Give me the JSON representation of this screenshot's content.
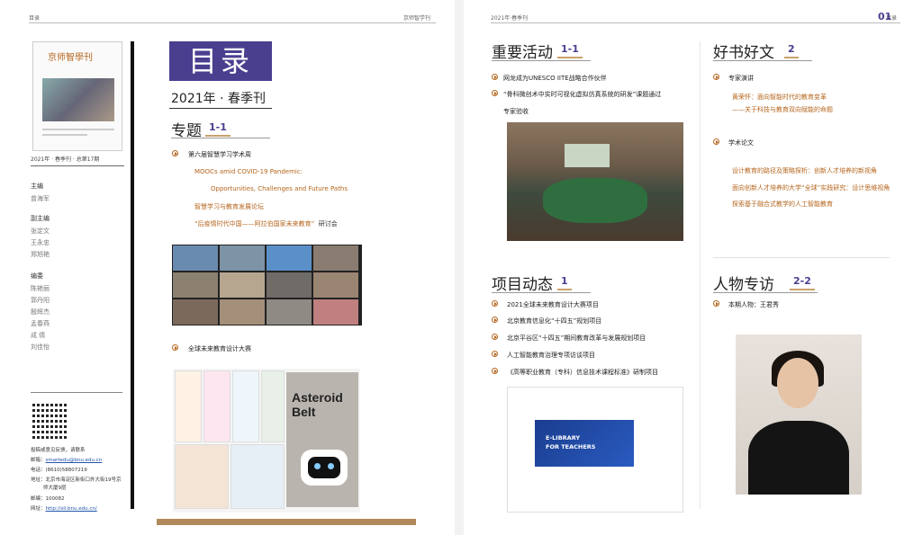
{
  "header": {
    "left_page_num": "目录",
    "left_journal": "京师智学刊",
    "right_issue": "2021年·春季刊",
    "right_label": "目录",
    "right_page_num": "01"
  },
  "cover": {
    "title": "京师智學刊",
    "issue_line": "2021年 · 春季刊 · 总第17期"
  },
  "staff": {
    "roles": [
      {
        "role": "主编",
        "names": [
          "曾海军"
        ]
      },
      {
        "role": "副主编",
        "names": [
          "张定文",
          "王永忠",
          "郑旭艳"
        ]
      },
      {
        "role": "编委",
        "names": [
          "陈艳丽",
          "郭丹阳",
          "殷辉杰",
          "孟春燕",
          "成 倩",
          "刘佳怡"
        ]
      }
    ]
  },
  "contact": {
    "heading": "投稿或意见反馈，请联系",
    "email_label": "邮箱：",
    "email": "smartedu@bnu.edu.cn",
    "phone_label": "电话：",
    "phone": "(8610)58807219",
    "address_label": "地址：",
    "address_1": "北京市海淀区新街口外大街19号京",
    "address_2": "师大厦9层",
    "zip_label": "邮编：",
    "zip": "100082",
    "site_label": "网址：",
    "site": "http://sli.bnu.edu.cn/"
  },
  "toc": {
    "title": "目录",
    "edition": "2021年 · 春季刊",
    "special": {
      "title": "专题",
      "num": "1-1",
      "item1": "第六届智慧学习学术周",
      "item1_subs": [
        "MOOCs amid COVID-19 Pandemic:",
        "Opportunities, Challenges and Future Paths",
        "智慧学习与教育发展论坛",
        "“后疫情时代中国——阿拉伯国家未来教育”"
      ],
      "item1_sub_suffix": "研讨会",
      "item2": "全球未来教育设计大赛"
    }
  },
  "collage": {
    "book_title_1": "Asteroid",
    "book_title_2": "Belt"
  },
  "events": {
    "title": "重要活动",
    "num": "1-1",
    "items": [
      "网龙成为UNESCO IITE战略合作伙伴",
      "“骨科微创术中实时可视化虚拟仿真系统的研发”课题通过"
    ],
    "item2_cont": "专家验收"
  },
  "projects": {
    "title": "项目动态",
    "num": "1",
    "items": [
      "2021全球未来教育设计大赛项目",
      "北京教育信息化“十四五”规划项目",
      "北京平谷区“十四五”期间教育改革与发展规划项目",
      "人工智能教育治理专项访谈项目",
      "《高等职业教育（专科）信息技术课程标准》研制项目"
    ],
    "doc_banner_1": "E-LIBRARY",
    "doc_banner_2": "FOR TEACHERS"
  },
  "books": {
    "title": "好书好文",
    "num": "2",
    "sub1": "专家演讲",
    "sub1_items": [
      "黄荣怀：面向智能时代的教育变革",
      "——关于科技与教育双向赋能的命题"
    ],
    "sub2": "学术论文",
    "sub2_items": [
      "设计教育的路径及策略探析：创新人才培养的新视角",
      "面向创新人才培养的大学“全球”实践研究：设计思维视角",
      "探索基于融合式教学的人工智能教育"
    ]
  },
  "people": {
    "title": "人物专访",
    "num": "2-2",
    "item": "本期人物：王君秀"
  }
}
